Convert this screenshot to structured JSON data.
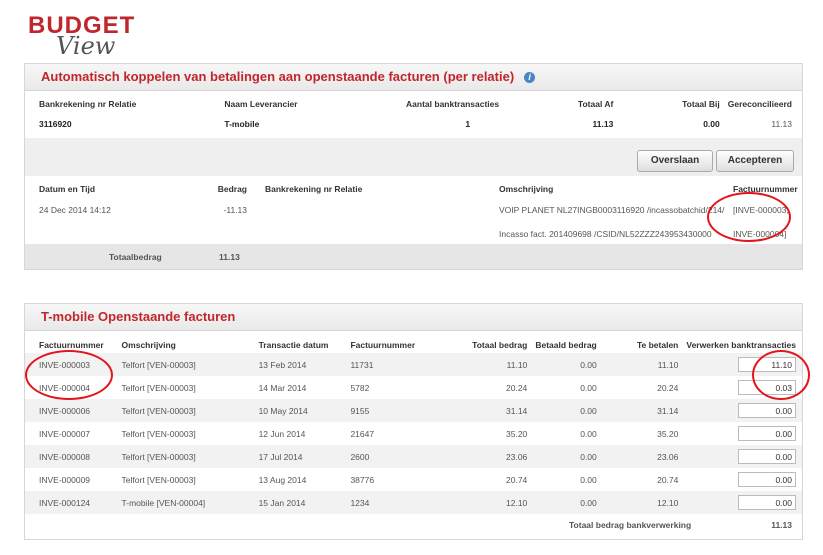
{
  "logo": {
    "word1": "BUDGET",
    "word2": "View"
  },
  "panel1": {
    "title": "Automatisch koppelen van betalingen aan openstaande facturen (per relatie)",
    "headers": [
      "Bankrekening nr Relatie",
      "Naam Leverancier",
      "Aantal banktransacties",
      "Totaal Af",
      "Totaal Bij",
      "Gereconcilieerd"
    ],
    "row": [
      "3116920",
      "T-mobile",
      "1",
      "11.13",
      "0.00",
      "11.13"
    ],
    "buttons": {
      "skip": "Overslaan",
      "accept": "Accepteren"
    },
    "tx_headers": [
      "Datum en Tijd",
      "Bedrag",
      "Bankrekening nr Relatie",
      "Omschrijving",
      "Factuurnummer"
    ],
    "tx": {
      "date": "24 Dec 2014 14:12",
      "amount": "-11.13",
      "desc1": "VOIP PLANET NL27INGB0003116920 /incassobatchid/214/",
      "desc2": "Incasso fact. 201409698 /CSID/NL52ZZZ243953430000",
      "inv1": "[INVE-000003,",
      "inv2": "INVE-000004]"
    },
    "total_label": "Totaalbedrag",
    "total_value": "11.13"
  },
  "panel2": {
    "title": "T-mobile Openstaande facturen",
    "headers": [
      "Factuurnummer",
      "Omschrijving",
      "Transactie datum",
      "Factuurnummer",
      "Totaal bedrag",
      "Betaald bedrag",
      "Te betalen",
      "Verwerken banktransacties"
    ],
    "rows": [
      {
        "inv": "INVE-000003",
        "desc": "Telfort [VEN-00003]",
        "date": "13 Feb 2014",
        "no": "11731",
        "total": "11.10",
        "paid": "0.00",
        "due": "11.10",
        "process": "11.10"
      },
      {
        "inv": "INVE-000004",
        "desc": "Telfort [VEN-00003]",
        "date": "14 Mar 2014",
        "no": "5782",
        "total": "20.24",
        "paid": "0.00",
        "due": "20.24",
        "process": "0.03"
      },
      {
        "inv": "INVE-000006",
        "desc": "Telfort [VEN-00003]",
        "date": "10 May 2014",
        "no": "9155",
        "total": "31.14",
        "paid": "0.00",
        "due": "31.14",
        "process": "0.00"
      },
      {
        "inv": "INVE-000007",
        "desc": "Telfort [VEN-00003]",
        "date": "12 Jun 2014",
        "no": "21647",
        "total": "35.20",
        "paid": "0.00",
        "due": "35.20",
        "process": "0.00"
      },
      {
        "inv": "INVE-000008",
        "desc": "Telfort [VEN-00003]",
        "date": "17 Jul 2014",
        "no": "2600",
        "total": "23.06",
        "paid": "0.00",
        "due": "23.06",
        "process": "0.00"
      },
      {
        "inv": "INVE-000009",
        "desc": "Telfort [VEN-00003]",
        "date": "13 Aug 2014",
        "no": "38776",
        "total": "20.74",
        "paid": "0.00",
        "due": "20.74",
        "process": "0.00"
      },
      {
        "inv": "INVE-000124",
        "desc": "T-mobile [VEN-00004]",
        "date": "15 Jan 2014",
        "no": "1234",
        "total": "12.10",
        "paid": "0.00",
        "due": "12.10",
        "process": "0.00"
      }
    ],
    "total_label": "Totaal bedrag bankverwerking",
    "total_value": "11.13"
  }
}
